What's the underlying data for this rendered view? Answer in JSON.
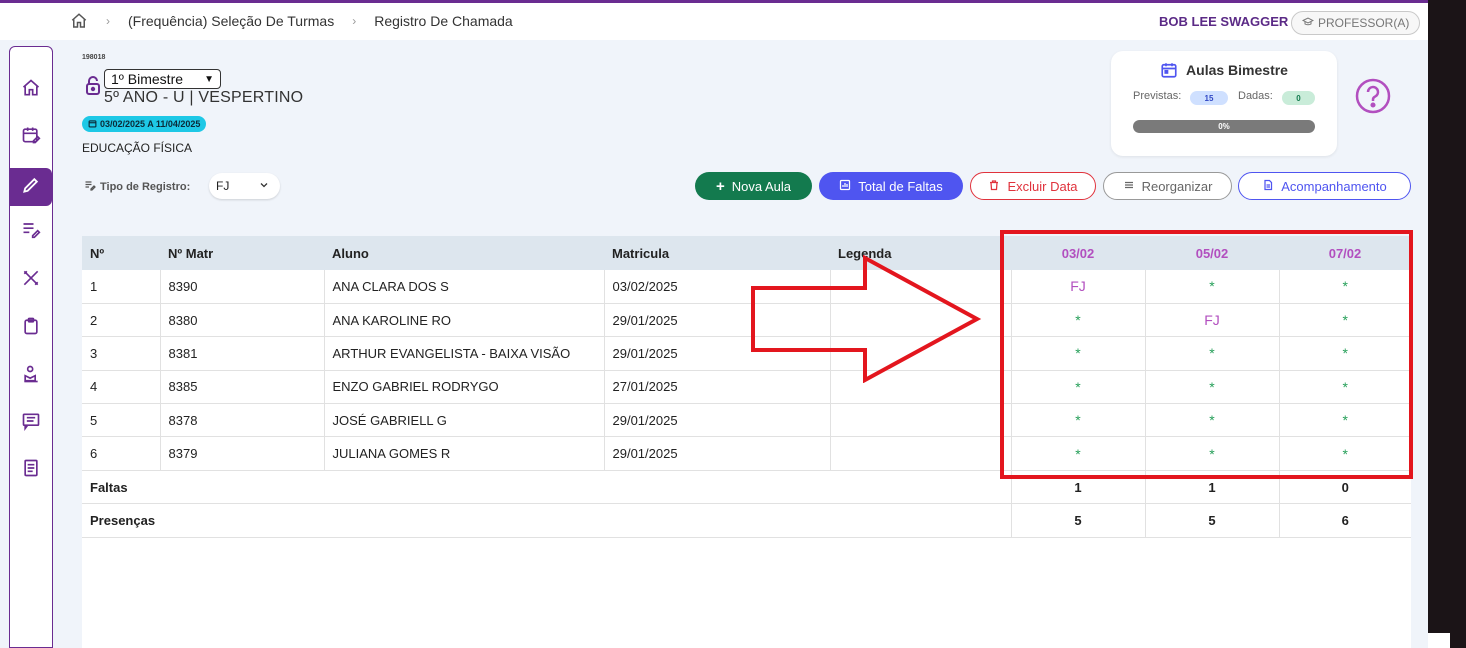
{
  "breadcrumb": {
    "home_icon": "home-icon",
    "items": [
      "(Frequência) Seleção De Turmas",
      "Registro De Chamada"
    ]
  },
  "user": {
    "name": "BOB LEE SWAGGER",
    "role": "PROFESSOR(A)"
  },
  "sidebar": {
    "items": [
      {
        "icon": "home-icon"
      },
      {
        "icon": "calendar-edit-icon"
      },
      {
        "icon": "pencil-icon",
        "active": true
      },
      {
        "icon": "list-edit-icon"
      },
      {
        "icon": "ruler-pencil-icon"
      },
      {
        "icon": "clipboard-icon"
      },
      {
        "icon": "reading-person-icon"
      },
      {
        "icon": "message-icon"
      },
      {
        "icon": "document-icon"
      }
    ]
  },
  "header": {
    "code": "198018",
    "bimestre": "1º Bimestre",
    "class_name": "5º ANO - U | VESPERTINO",
    "period": "03/02/2025 A 11/04/2025",
    "subject": "EDUCAÇÃO FÍSICA"
  },
  "tipo_registro": {
    "label": "Tipo de Registro:",
    "value": "FJ"
  },
  "aulas_card": {
    "title": "Aulas Bimestre",
    "previstas_label": "Previstas:",
    "previstas_value": "15",
    "dadas_label": "Dadas:",
    "dadas_value": "0",
    "progress_label": "0%",
    "progress": 0
  },
  "buttons": {
    "nova_aula": "Nova Aula",
    "total_faltas": "Total de Faltas",
    "excluir_data": "Excluir Data",
    "reorganizar": "Reorganizar",
    "acompanhamento": "Acompanhamento"
  },
  "table": {
    "columns": [
      "Nº",
      "Nº Matr",
      "Aluno",
      "Matricula",
      "Legenda"
    ],
    "dates": [
      "03/02",
      "05/02",
      "07/02"
    ],
    "rows": [
      {
        "n": "1",
        "matr": "8390",
        "aluno": "ANA CLARA DOS S",
        "matricula": "03/02/2025",
        "legenda": "",
        "marks": [
          "FJ",
          "*",
          "*"
        ]
      },
      {
        "n": "2",
        "matr": "8380",
        "aluno": "ANA KAROLINE RO",
        "matricula": "29/01/2025",
        "legenda": "",
        "marks": [
          "*",
          "FJ",
          "*"
        ]
      },
      {
        "n": "3",
        "matr": "8381",
        "aluno": "ARTHUR EVANGELISTA - BAIXA VISÃO",
        "matricula": "29/01/2025",
        "legenda": "",
        "marks": [
          "*",
          "*",
          "*"
        ]
      },
      {
        "n": "4",
        "matr": "8385",
        "aluno": "ENZO GABRIEL RODRYGO",
        "matricula": "27/01/2025",
        "legenda": "",
        "marks": [
          "*",
          "*",
          "*"
        ]
      },
      {
        "n": "5",
        "matr": "8378",
        "aluno": "JOSÉ GABRIELL G",
        "matricula": "29/01/2025",
        "legenda": "",
        "marks": [
          "*",
          "*",
          "*"
        ]
      },
      {
        "n": "6",
        "matr": "8379",
        "aluno": "JULIANA GOMES R",
        "matricula": "29/01/2025",
        "legenda": "",
        "marks": [
          "*",
          "*",
          "*"
        ]
      }
    ],
    "faltas_label": "Faltas",
    "faltas": [
      "1",
      "1",
      "0"
    ],
    "presencas_label": "Presenças",
    "presencas": [
      "5",
      "5",
      "6"
    ]
  },
  "colors": {
    "brand": "#6a2c91",
    "accent_pink": "#b24fbf",
    "present_green": "#27a05a",
    "highlight_red": "#e3161e"
  }
}
